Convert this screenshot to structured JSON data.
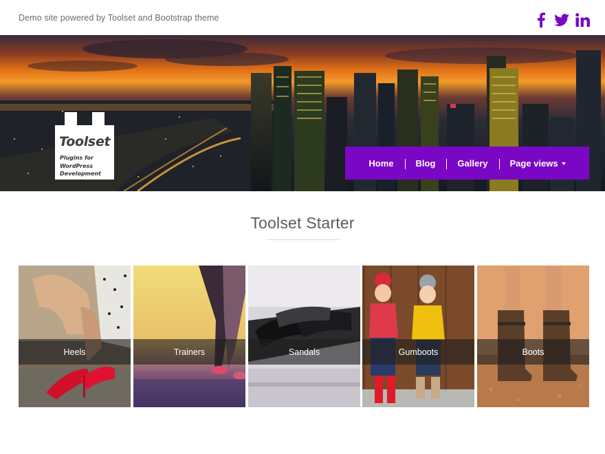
{
  "header": {
    "tagline": "Demo site powered by Toolset and Bootstrap theme",
    "socials": [
      {
        "icon": "facebook-icon"
      },
      {
        "icon": "twitter-icon"
      },
      {
        "icon": "linkedin-icon"
      }
    ]
  },
  "logo": {
    "brand": "Toolset",
    "tagline_lines": [
      "Plugins for",
      "WordPress",
      "Development"
    ]
  },
  "nav": {
    "items": [
      {
        "label": "Home"
      },
      {
        "label": "Blog"
      },
      {
        "label": "Gallery"
      },
      {
        "label": "Page views",
        "dropdown": true
      }
    ]
  },
  "main": {
    "title": "Toolset Starter"
  },
  "categories": [
    {
      "label": "Heels"
    },
    {
      "label": "Trainers"
    },
    {
      "label": "Sandals"
    },
    {
      "label": "Gumboots"
    },
    {
      "label": "Boots"
    }
  ],
  "colors": {
    "accent": "#7a07c4",
    "social": "#7a07c4"
  }
}
